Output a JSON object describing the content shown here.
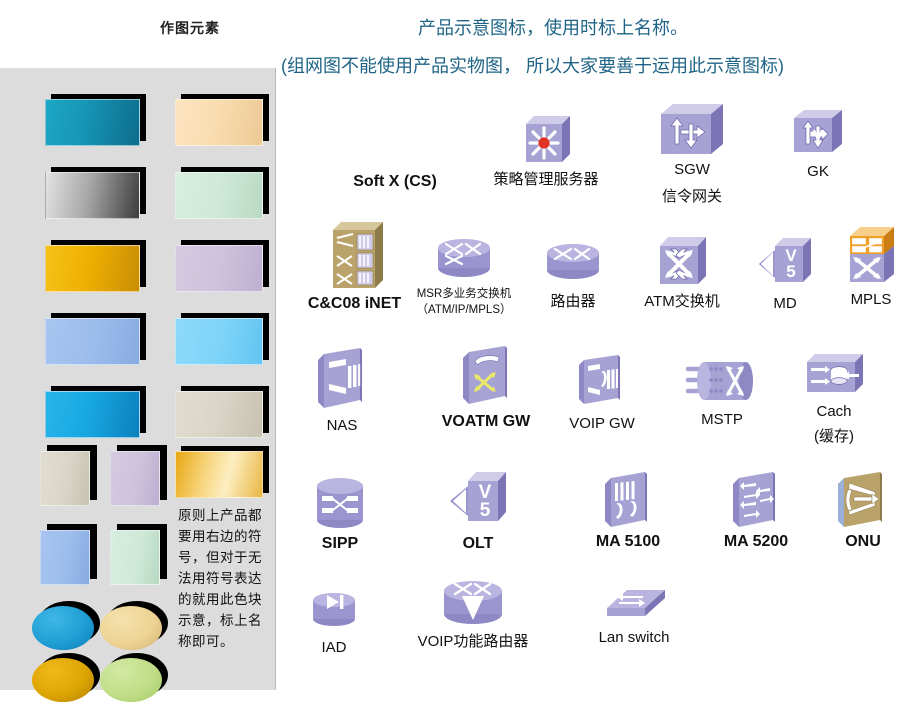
{
  "header": {
    "left_title": "作图元素",
    "line1": "产品示意图标，使用时标上名称。",
    "line2": "(组网图不能使用产品实物图， 所以大家要善于运用此示意图标)",
    "accent_color": "#1f6487"
  },
  "sidebar": {
    "background": "#dcdcdc",
    "note": "原则上产品都要用右边的符号，但对于无法用符号表达的就用此色块示意，标上名称即可。",
    "wide_blocks": [
      {
        "name": "block-teal",
        "color_light": "#1796b6",
        "color_dark": "#0d6d8c"
      },
      {
        "name": "block-peach",
        "color_light": "#fadfb4",
        "color_dark": "#f0cf9b"
      },
      {
        "name": "block-gray",
        "color_light": "#d8d8d8",
        "color_dark": "#4a4a4a"
      },
      {
        "name": "block-mint",
        "color_light": "#cfe9d8",
        "color_dark": "#bcdcc7"
      },
      {
        "name": "block-gold",
        "color_light": "#f0b400",
        "color_dark": "#c98d06"
      },
      {
        "name": "block-lavender",
        "color_light": "#cfc3dd",
        "color_dark": "#bfb2d2"
      },
      {
        "name": "block-cornflower",
        "color_light": "#9ebdee",
        "color_dark": "#8fb0e4"
      },
      {
        "name": "block-skyblue",
        "color_light": "#7fd4f8",
        "color_dark": "#6cc9f3"
      },
      {
        "name": "block-cyan",
        "color_light": "#18a8e0",
        "color_dark": "#0d87c4"
      },
      {
        "name": "block-sand",
        "color_light": "#d9d5c6",
        "color_dark": "#cac5b4"
      }
    ],
    "small_blocks": [
      {
        "name": "small-block-sand",
        "color": "#d9d5c6"
      },
      {
        "name": "small-block-lavender",
        "color": "#cfc3dd"
      },
      {
        "name": "small-block-gold-grad",
        "color": "#f3cf6b"
      },
      {
        "name": "small-block-cornflower",
        "color": "#9ebdee"
      },
      {
        "name": "small-block-mint",
        "color": "#cfe9d8"
      }
    ],
    "ellipses": [
      {
        "name": "ellipse-cyan",
        "color_light": "#2aa9dd",
        "color_dark": "#0f84bd"
      },
      {
        "name": "ellipse-tan",
        "color_light": "#f0d79a",
        "color_dark": "#d9bb78"
      },
      {
        "name": "ellipse-gold",
        "color_light": "#e0a806",
        "color_dark": "#b98703"
      },
      {
        "name": "ellipse-green",
        "color_light": "#c3e08a",
        "color_dark": "#a8cc66"
      }
    ]
  },
  "icons": {
    "row1": [
      {
        "id": "soft-x-cs",
        "label": "Soft X (CS)",
        "bold": true,
        "shape": "none"
      },
      {
        "id": "policy-server",
        "label": "策略管理服务器",
        "bold": false,
        "shape": "cube-star"
      },
      {
        "id": "sgw",
        "label": "SGW",
        "label2": "信令网关",
        "bold": false,
        "shape": "cube-arrows"
      },
      {
        "id": "gk",
        "label": "GK",
        "bold": false,
        "shape": "cube-gk"
      }
    ],
    "row2": [
      {
        "id": "cc08-inet",
        "label": "C&C08 iNET",
        "bold": true,
        "shape": "cabinet"
      },
      {
        "id": "msr-switch",
        "label": "MSR多业务交换机",
        "label2": "（ATM/IP/MPLS）",
        "bold": false,
        "shape": "router-x"
      },
      {
        "id": "router",
        "label": "路由器",
        "bold": false,
        "shape": "router-x2"
      },
      {
        "id": "atm-switch",
        "label": "ATM交换机",
        "bold": false,
        "shape": "cube-x"
      },
      {
        "id": "md",
        "label": "MD",
        "bold": false,
        "shape": "cube-v5"
      },
      {
        "id": "mpls",
        "label": "MPLS",
        "bold": false,
        "shape": "cube-mpls"
      }
    ],
    "row3": [
      {
        "id": "nas",
        "label": "NAS",
        "bold": false,
        "shape": "panel-nas"
      },
      {
        "id": "voatm-gw",
        "label": "VOATM GW",
        "bold": true,
        "shape": "panel-voatm"
      },
      {
        "id": "voip-gw",
        "label": "VOIP GW",
        "bold": false,
        "shape": "panel-voip"
      },
      {
        "id": "mstp",
        "label": "MSTP",
        "bold": false,
        "shape": "mstp"
      },
      {
        "id": "cach",
        "label": "Cach",
        "label2": "(缓存)",
        "bold": false,
        "shape": "cache"
      }
    ],
    "row4": [
      {
        "id": "sipp",
        "label": "SIPP",
        "bold": true,
        "shape": "cyl-sipp"
      },
      {
        "id": "olt",
        "label": "OLT",
        "bold": true,
        "shape": "cube-v5b"
      },
      {
        "id": "ma5100",
        "label": "MA 5100",
        "bold": true,
        "shape": "panel-ma5100"
      },
      {
        "id": "ma5200",
        "label": "MA 5200",
        "bold": true,
        "shape": "panel-ma5200"
      },
      {
        "id": "onu",
        "label": "ONU",
        "bold": true,
        "shape": "panel-onu"
      }
    ],
    "row5": [
      {
        "id": "iad",
        "label": "IAD",
        "bold": false,
        "shape": "cyl-iad"
      },
      {
        "id": "voip-router",
        "label": "VOIP功能路由器",
        "bold": false,
        "shape": "router-v"
      },
      {
        "id": "lan-switch",
        "label": "Lan switch",
        "bold": false,
        "shape": "lanswitch"
      }
    ]
  },
  "palette": {
    "purple_light": "#b9b5e0",
    "purple_mid": "#a7a2d4",
    "purple_dark": "#8e88c4",
    "purple_deep": "#7b75b5",
    "khaki": "#b9a36a",
    "khaki_dark": "#9a854f",
    "orange": "#f0a02a",
    "red_dot": "#e03124",
    "yellow": "#e8e86a"
  }
}
